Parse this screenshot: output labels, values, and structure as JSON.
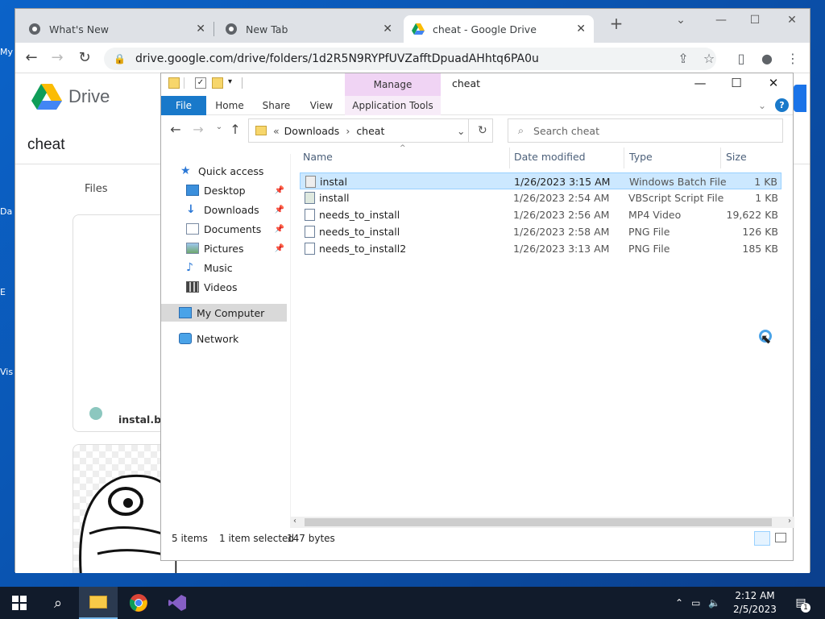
{
  "desktop": {
    "icon_labels": [
      "My",
      "Da",
      "E",
      "Vis"
    ]
  },
  "browser": {
    "tabs": [
      {
        "label": "What's New",
        "active": false
      },
      {
        "label": "New Tab",
        "active": false
      },
      {
        "label": "cheat - Google Drive",
        "active": true
      }
    ],
    "url": "drive.google.com/drive/folders/1d2R5N9RYPfUVZafftDpuadAHhtq6PA0u"
  },
  "drive": {
    "brand": "Drive",
    "folder_title": "cheat",
    "files_label": "Files",
    "card1_filename": "instal.bat"
  },
  "explorer": {
    "window_title": "cheat",
    "manage_label": "Manage",
    "ribbon_tabs": [
      "File",
      "Home",
      "Share",
      "View",
      "Application Tools"
    ],
    "breadcrumb": [
      "Downloads",
      "cheat"
    ],
    "search_placeholder": "Search cheat",
    "nav": {
      "quick_access": "Quick access",
      "desktop": "Desktop",
      "downloads": "Downloads",
      "documents": "Documents",
      "pictures": "Pictures",
      "music": "Music",
      "videos": "Videos",
      "my_computer": "My Computer",
      "network": "Network"
    },
    "columns": [
      "Name",
      "Date modified",
      "Type",
      "Size"
    ],
    "files": [
      {
        "name": "instal",
        "date": "1/26/2023 3:15 AM",
        "type": "Windows Batch File",
        "size": "1 KB",
        "selected": true
      },
      {
        "name": "install",
        "date": "1/26/2023 2:54 AM",
        "type": "VBScript Script File",
        "size": "1 KB",
        "selected": false
      },
      {
        "name": "needs_to_install",
        "date": "1/26/2023 2:56 AM",
        "type": "MP4 Video",
        "size": "19,622 KB",
        "selected": false
      },
      {
        "name": "needs_to_install",
        "date": "1/26/2023 2:58 AM",
        "type": "PNG File",
        "size": "126 KB",
        "selected": false
      },
      {
        "name": "needs_to_install2",
        "date": "1/26/2023 3:13 AM",
        "type": "PNG File",
        "size": "185 KB",
        "selected": false
      }
    ],
    "status": {
      "item_count": "5 items",
      "selection": "1 item selected",
      "bytes": "147 bytes"
    }
  },
  "taskbar": {
    "time": "2:12 AM",
    "date": "2/5/2023",
    "notification_count": "1"
  },
  "colors": {
    "accent": "#1979ca",
    "selection": "#cce8ff",
    "manage_tab": "#f0d4f4",
    "taskbar": "#111b2b"
  }
}
